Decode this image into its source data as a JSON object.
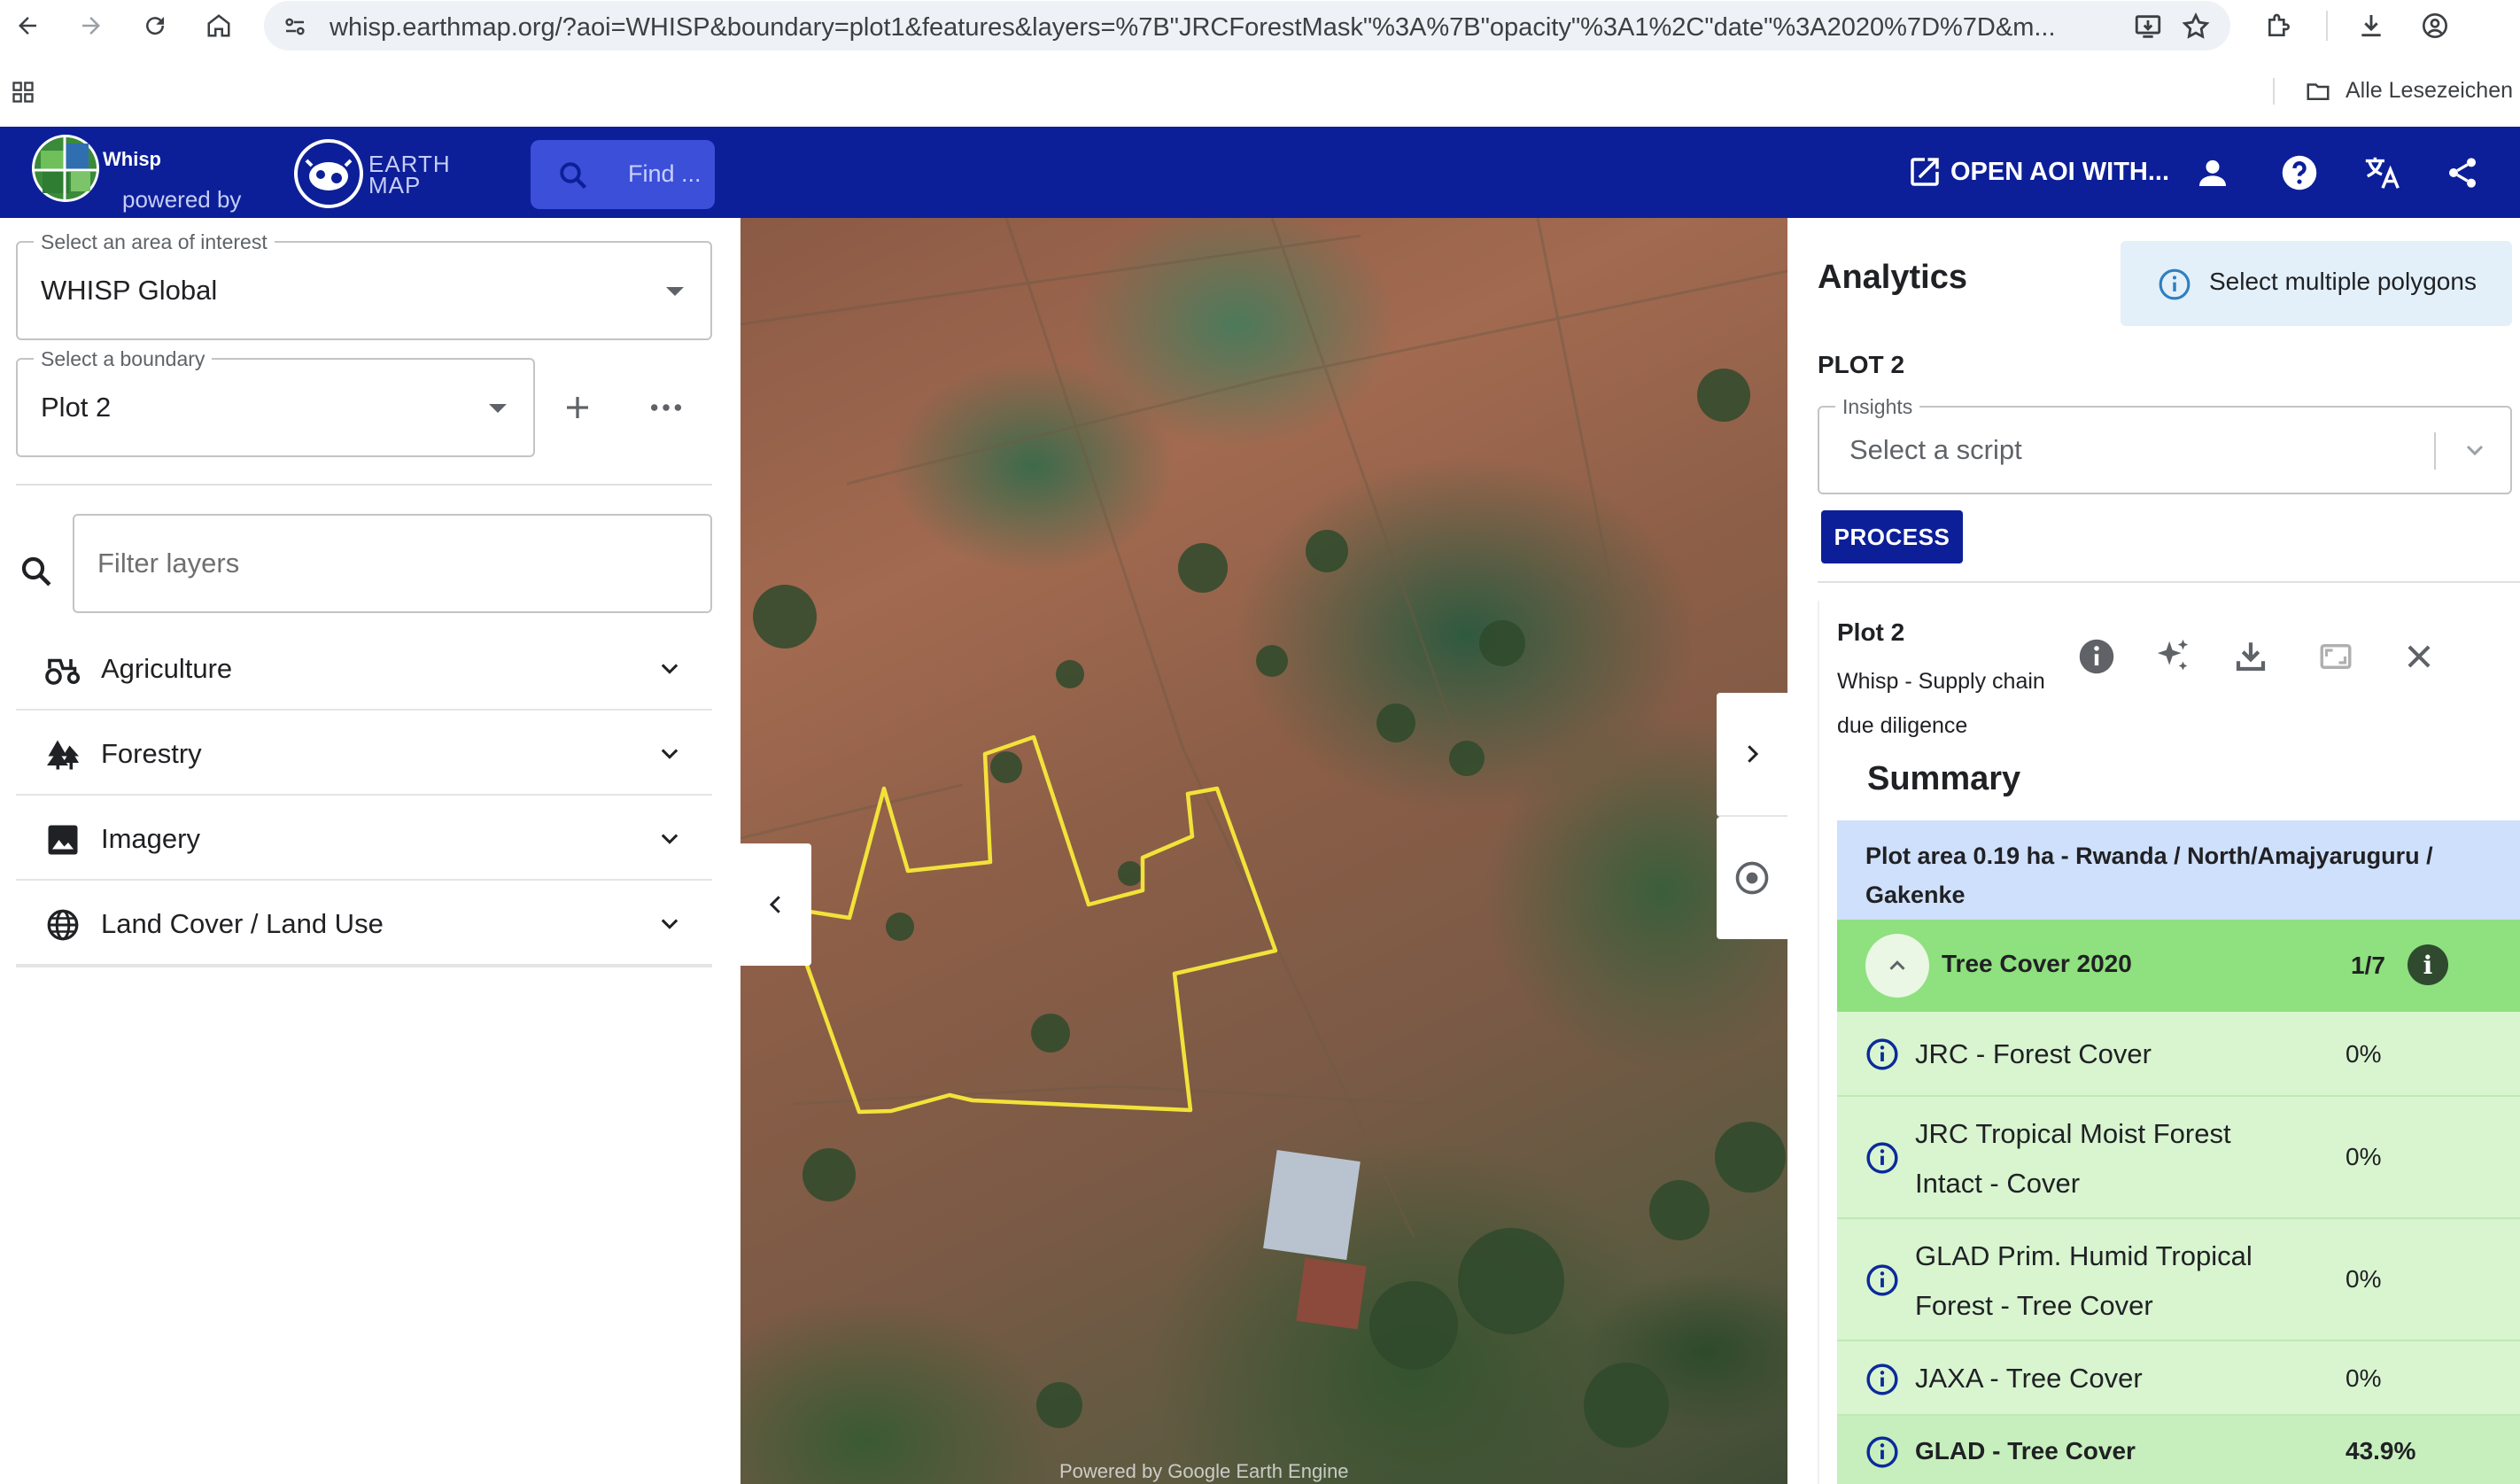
{
  "browser": {
    "url": "whisp.earthmap.org/?aoi=WHISP&boundary=plot1&features&layers=%7B\"JRCForestMask\"%3A%7B\"opacity\"%3A1%2C\"date\"%3A2020%7D%7D&m...",
    "bookmarks_label": "Alle Lesezeichen"
  },
  "header": {
    "logo_text": "Whisp",
    "powered_by": "powered by",
    "earthmap_line1": "EARTH",
    "earthmap_line2": "MAP",
    "search_placeholder": "Find ...",
    "open_aoi_label": "OPEN AOI WITH..."
  },
  "left_panel": {
    "aoi_label": "Select an area of interest",
    "aoi_value": "WHISP Global",
    "boundary_label": "Select a boundary",
    "boundary_value": "Plot 2",
    "filter_placeholder": "Filter layers",
    "categories": [
      {
        "label": "Agriculture",
        "icon": "tractor-icon"
      },
      {
        "label": "Forestry",
        "icon": "forest-icon"
      },
      {
        "label": "Imagery",
        "icon": "image-icon"
      },
      {
        "label": "Land Cover / Land Use",
        "icon": "globe-icon"
      }
    ]
  },
  "map": {
    "credit": "Powered by Google Earth Engine",
    "polygon_color": "#f2e23a"
  },
  "right_panel": {
    "title": "Analytics",
    "multi_select_label": "Select multiple polygons",
    "plot_heading": "PLOT 2",
    "insights_label": "Insights",
    "insights_placeholder": "Select a script",
    "process_label": "PROCESS",
    "card": {
      "title": "Plot 2",
      "subtitle": "Whisp - Supply chain due diligence",
      "summary_title": "Summary",
      "area_text": "Plot area 0.19 ha - Rwanda / North/Amajyaruguru / Gakenke",
      "tree_cover": {
        "label": "Tree Cover 2020",
        "count": "1/7",
        "metrics": [
          {
            "name": "JRC - Forest Cover",
            "value": "0%"
          },
          {
            "name": "JRC Tropical Moist Forest Intact - Cover",
            "value": "0%"
          },
          {
            "name": "GLAD Prim. Humid Tropical Forest - Tree Cover",
            "value": "0%"
          },
          {
            "name": "JAXA - Tree Cover",
            "value": "0%"
          },
          {
            "name": "GLAD - Tree Cover",
            "value": "43.9%"
          }
        ]
      }
    }
  },
  "colors": {
    "header_bg": "#0c1f99",
    "summary_area_bg": "#cfe0fc",
    "tree_cover_header_bg": "#8fe07f",
    "tree_cover_row_bg": "#d8f5d0"
  }
}
